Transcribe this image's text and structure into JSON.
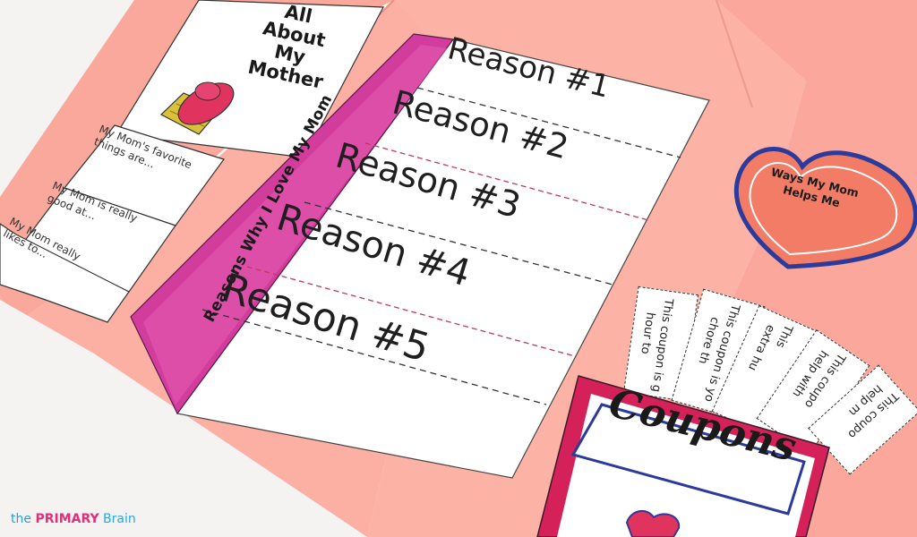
{
  "title_card": {
    "title_lines": [
      "All",
      "About",
      "My",
      "Mother"
    ]
  },
  "left_flaps": [
    {
      "text": "My Mom's favorite things are..."
    },
    {
      "text": "My Mom is really good at..."
    },
    {
      "text": "My Mom really likes to..."
    }
  ],
  "booklet": {
    "spine_label": "Reasons Why I Love My Mom",
    "reasons": [
      "Reason #1",
      "Reason #2",
      "Reason #3",
      "Reason #4",
      "Reason #5"
    ]
  },
  "heart": {
    "label": "Ways My Mom Helps Me"
  },
  "coupons": {
    "title": "Coupons",
    "strips": [
      {
        "lines": [
          "This coupon is g",
          "hour to"
        ]
      },
      {
        "lines": [
          "This coupon is yo",
          "chore th"
        ]
      },
      {
        "lines": [
          "This",
          "extra hu"
        ]
      },
      {
        "lines": [
          "This coupo",
          "help with"
        ]
      },
      {
        "lines": [
          "This coupo",
          "help m"
        ]
      }
    ]
  },
  "brand": {
    "part1": "the ",
    "part2": "PRIMARY",
    "part3": " Brain"
  },
  "colors": {
    "pink_paper": "#fba99d",
    "magenta_spine": "#d23c9c",
    "heart_outline": "#2b3a9b",
    "coupon_border": "#d4215a",
    "cupcake_frosting": "#e0345e",
    "cupcake_liner": "#d9c23a"
  }
}
